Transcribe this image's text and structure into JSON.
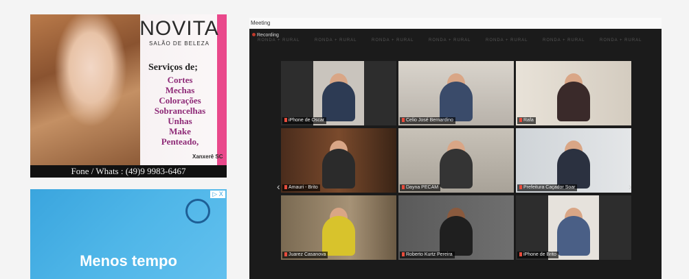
{
  "ad_novita": {
    "brand": "NOVITA",
    "brand_sub": "SALÃO DE BELEZA",
    "services_title": "Serviços de;",
    "services": [
      "Cortes",
      "Mechas",
      "Colorações",
      "Sobrancelhas",
      "Unhas",
      "Make",
      "Penteado,"
    ],
    "city": "Xanxerê SC",
    "contact": "Fone / Whats : (49)9 9983-6467",
    "colors": {
      "accent_pink": "#e9488b",
      "services_text": "#8e2a77"
    }
  },
  "ad_blue": {
    "close_chip": "▷ X",
    "headline": "Menos tempo"
  },
  "meeting": {
    "window_title": "Meeting",
    "recording_label": "Recording",
    "watermark": "RONDA\n+ RURAL",
    "nav_left": "‹",
    "nav_right": "›",
    "tiles": [
      {
        "label": "iPhone de Oscar",
        "active": true,
        "mic_icon": "mic-icon"
      },
      {
        "label": "Celio José Bernardino",
        "active": false
      },
      {
        "label": "Rafa",
        "active": false
      },
      {
        "label": "Amauri - Brito",
        "active": false
      },
      {
        "label": "Dayna PECAM",
        "active": false
      },
      {
        "label": "Prefeitura Caçador Soar",
        "active": false
      },
      {
        "label": "Juarez Casanova",
        "active": false
      },
      {
        "label": "Roberto Kurtz Pereira",
        "active": false
      },
      {
        "label": "iPhone de Brito",
        "active": false
      }
    ]
  }
}
